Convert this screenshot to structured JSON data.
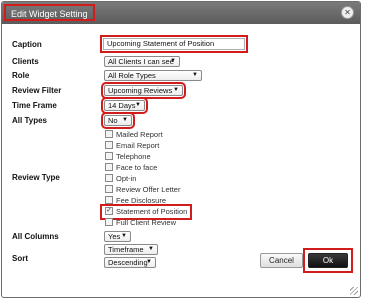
{
  "dialog": {
    "title": "Edit Widget Setting",
    "close_glyph": "✕"
  },
  "labels": {
    "caption": "Caption",
    "clients": "Clients",
    "role": "Role",
    "review_filter": "Review Filter",
    "time_frame": "Time Frame",
    "all_types": "All Types",
    "review_type": "Review Type",
    "all_columns": "All Columns",
    "sort": "Sort"
  },
  "fields": {
    "caption": "Upcoming Statement of Position",
    "clients": "All Clients I can see",
    "role": "All Role Types",
    "review_filter": "Upcoming Reviews",
    "time_frame": "14 Days",
    "all_types": "No",
    "all_columns": "Yes",
    "sort_by": "Timeframe",
    "sort_order": "Descending"
  },
  "review_types": [
    {
      "label": "Mailed Report",
      "checked": false
    },
    {
      "label": "Email Report",
      "checked": false
    },
    {
      "label": "Telephone",
      "checked": false
    },
    {
      "label": "Face to face",
      "checked": false
    },
    {
      "label": "Opt-in",
      "checked": false
    },
    {
      "label": "Review Offer Letter",
      "checked": false
    },
    {
      "label": "Fee Disclosure",
      "checked": false
    },
    {
      "label": "Statement of Position",
      "checked": true
    },
    {
      "label": "Full Client Review",
      "checked": false
    }
  ],
  "buttons": {
    "cancel": "Cancel",
    "ok": "Ok"
  },
  "colors": {
    "highlight": "#d11c1c",
    "titlebar": "#6a6a6a",
    "ok_button": "#1a1a1a"
  }
}
